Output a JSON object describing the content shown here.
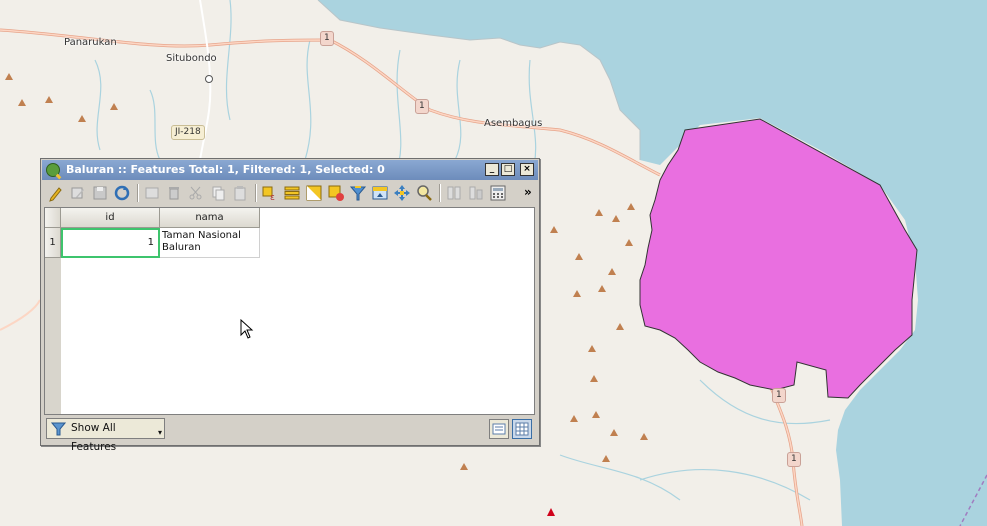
{
  "map": {
    "places": [
      {
        "label": "Panarukan"
      },
      {
        "label": "Situbondo"
      },
      {
        "label": "Asembagus"
      }
    ],
    "road_shields": [
      "1",
      "1",
      "JI-218",
      "1",
      "1"
    ],
    "polygon_fill_color": "#e96fe0",
    "water_color": "#aad3df",
    "land_color": "#f2efe9"
  },
  "window": {
    "title": "Baluran :: Features Total: 1, Filtered: 1, Selected: 0",
    "buttons": {
      "minimize": "_",
      "maximize": "□",
      "close": "×"
    },
    "toolbar_icons": [
      "toggle-editing-icon",
      "multi-edit-icon",
      "save-edits-icon",
      "reload-icon",
      "add-feature-icon",
      "delete-feature-icon",
      "cut-icon",
      "copy-icon",
      "paste-icon",
      "select-expression-icon",
      "select-all-icon",
      "invert-selection-icon",
      "deselect-all-icon",
      "filter-selected-icon",
      "move-selection-top-icon",
      "pan-to-selected-icon",
      "zoom-to-selected-icon",
      "new-field-icon",
      "delete-field-icon",
      "field-calculator-icon",
      "more-icon"
    ],
    "more_label": "»",
    "table": {
      "columns": [
        "id",
        "nama"
      ],
      "rows": [
        {
          "row_header": "1",
          "id": "1",
          "nama_line1": "Taman Nasional",
          "nama_line2": "Baluran"
        }
      ]
    },
    "filter_button_label": "Show All Features",
    "view_buttons": [
      "form-view-icon",
      "table-view-icon"
    ]
  }
}
